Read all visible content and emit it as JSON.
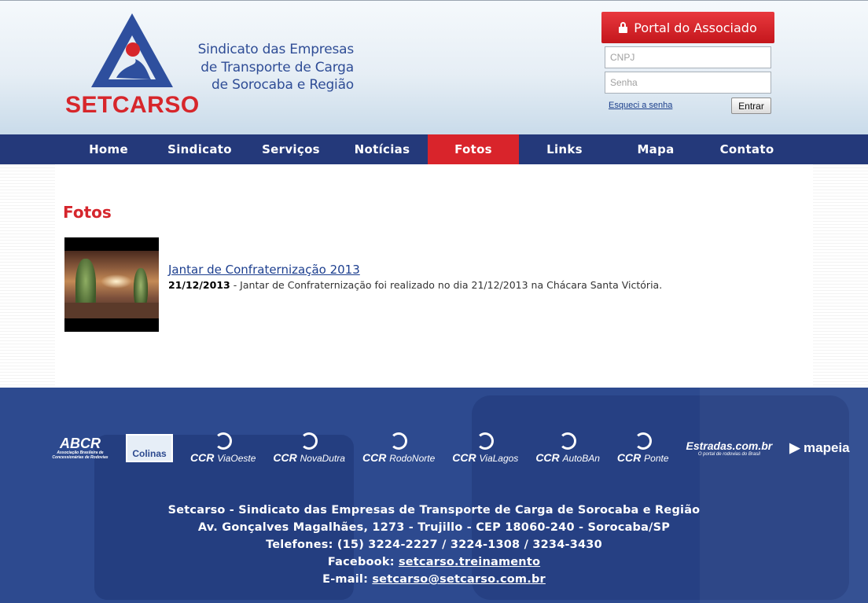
{
  "header": {
    "logo_text": "SETCARSO",
    "tagline": [
      "Sindicato das Empresas",
      "de Transporte de Carga",
      "de Sorocaba e Região"
    ],
    "portal_label": "Portal do Associado",
    "cnpj_placeholder": "CNPJ",
    "senha_placeholder": "Senha",
    "forgot_label": "Esqueci a senha",
    "login_button": "Entrar"
  },
  "nav": {
    "items": [
      "Home",
      "Sindicato",
      "Serviços",
      "Notícias",
      "Fotos",
      "Links",
      "Mapa",
      "Contato"
    ],
    "active": "Fotos"
  },
  "main": {
    "title": "Fotos",
    "items": [
      {
        "title": "Jantar de Confraternização 2013",
        "date": "21/12/2013",
        "description": " - Jantar de Confraternização foi realizado no dia 21/12/2013 na Chácara Santa Victória."
      }
    ]
  },
  "footer": {
    "partners": {
      "abcr": "ABCR",
      "abcr_sub": "Associação Brasileira de Concessionárias de Rodovias",
      "colinas": "Colinas",
      "ccr": [
        "ViaOeste",
        "NovaDutra",
        "RodoNorte",
        "ViaLagos",
        "AutoBAn",
        "Ponte"
      ],
      "ccr_brand": "CCR",
      "estradas": "Estradas.com.br",
      "estradas_sub": "O portal de rodovias do Brasil",
      "mapeia": "mapeia"
    },
    "line1": "Setcarso - Sindicato das Empresas de Transporte de Carga de Sorocaba e Região",
    "line2": "Av. Gonçalves Magalhães, 1273 - Trujillo - CEP 18060-240 - Sorocaba/SP",
    "line3": "Telefones: (15) 3224-2227 / 3224-1308 / 3234-3430",
    "facebook_label": "Facebook: ",
    "facebook_link": "setcarso.treinamento",
    "email_label": "E-mail: ",
    "email_link": "setcarso@setcarso.com.br"
  },
  "colors": {
    "brand_blue": "#24397a",
    "brand_red": "#d9242b"
  }
}
